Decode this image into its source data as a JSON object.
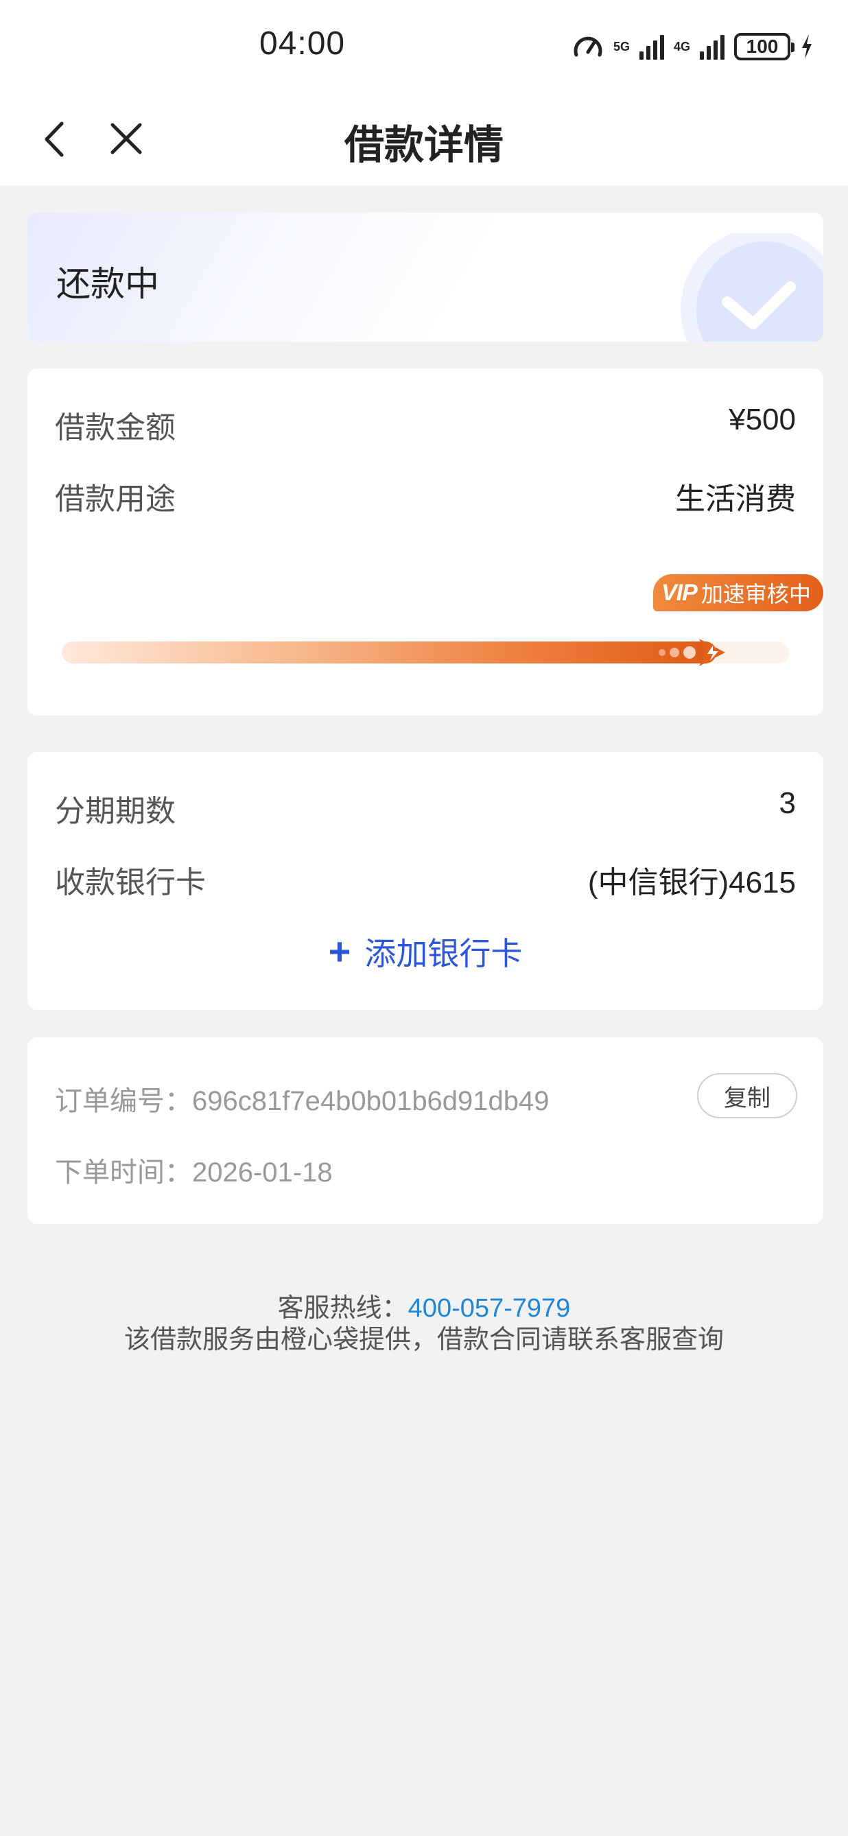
{
  "status_bar": {
    "time": "04:00",
    "network1": "5G",
    "network2": "4G",
    "battery": "100",
    "icons": [
      "speed-icon",
      "signal-icon",
      "signal-icon",
      "battery-icon",
      "charging-icon"
    ]
  },
  "nav": {
    "title": "借款详情",
    "back_icon": "chevron-left-icon",
    "close_icon": "close-icon"
  },
  "status_card": {
    "text": "还款中",
    "icon": "check-circle-icon"
  },
  "loan": {
    "amount_label": "借款金额",
    "amount_value": "¥500",
    "purpose_label": "借款用途",
    "purpose_value": "生活消费",
    "badge_vip": "VIP",
    "badge_text": "加速审核中",
    "progress": 0.9,
    "colors": {
      "accent": "#e2601b",
      "track": "#fdf3ea"
    }
  },
  "plan": {
    "periods_label": "分期期数",
    "periods_value": "3",
    "bank_label": "收款银行卡",
    "bank_value": "(中信银行)4615",
    "add_card_label": "添加银行卡",
    "add_color": "#2b57d8"
  },
  "order": {
    "number_label": "订单编号：",
    "number_value": "696c81f7e4b0b01b6d91db49",
    "copy_label": "复制",
    "time_label": "下单时间：",
    "time_value": "2026-01-18"
  },
  "footer": {
    "hotline_label": "客服热线：",
    "hotline_number": "400-057-7979",
    "note": "该借款服务由橙心袋提供，借款合同请联系客服查询"
  }
}
